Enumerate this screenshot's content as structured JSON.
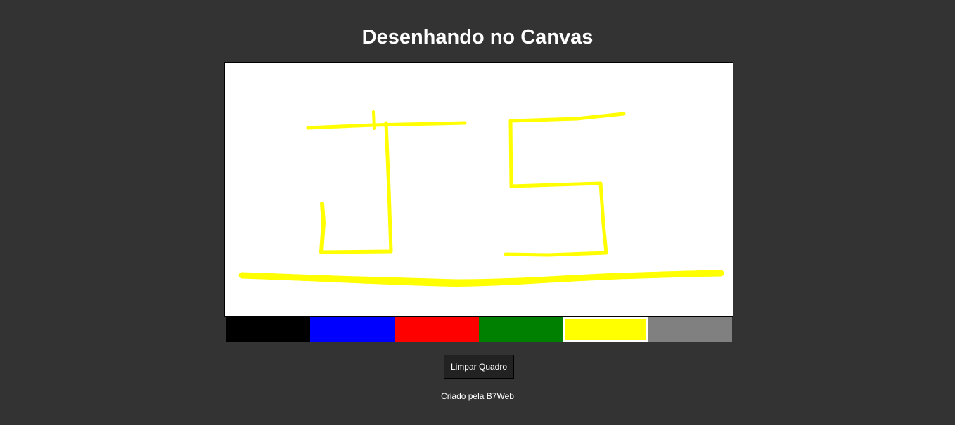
{
  "header": {
    "title": "Desenhando no Canvas"
  },
  "canvas": {
    "background": "#ffffff",
    "stroke_color": "#ffff00"
  },
  "palette": {
    "colors": [
      "#000000",
      "#0000ff",
      "#ff0000",
      "#008000",
      "#ffff00",
      "#808080"
    ],
    "selected": "#ffff00"
  },
  "actions": {
    "clear_label": "Limpar Quadro"
  },
  "footer": {
    "credit": "Criado pela B7Web"
  }
}
